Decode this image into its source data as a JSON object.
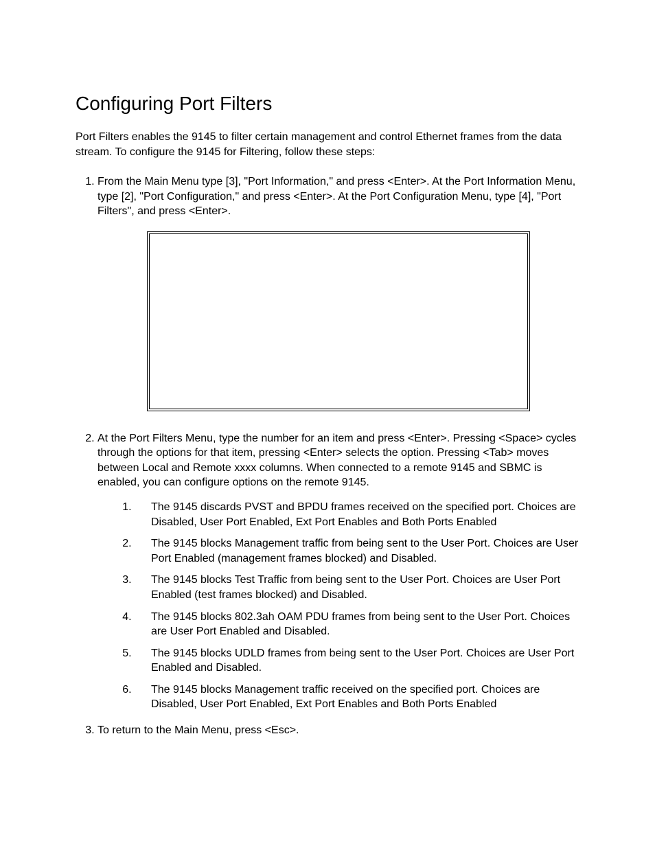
{
  "title": "Configuring Port Filters",
  "intro": "Port Filters enables the 9145 to filter certain management and control Ethernet frames from the data stream.  To configure the 9145 for Filtering, follow these steps:",
  "steps": {
    "s1": "From the Main Menu type [3], \"Port Information,\" and press <Enter>.  At the Port Information Menu, type [2], \"Port Configuration,\" and press <Enter>.  At the Port Configuration Menu, type [4], \"Port Filters\", and press <Enter>.",
    "s2": "At the Port Filters Menu, type the number for an item and press <Enter>.  Pressing <Space> cycles through the options for that item, pressing <Enter> selects the option.  Pressing <Tab> moves between Local and Remote xxxx columns.  When connected to a remote 9145 and SBMC is enabled, you can configure options on the remote 9145.",
    "s3": "To return to the Main Menu, press <Esc>."
  },
  "subitems": {
    "i1": "The 9145 discards PVST and BPDU frames received on the specified port. Choices are Disabled, User Port Enabled, Ext Port Enables and Both Ports Enabled",
    "i2": "The 9145 blocks Management traffic from being sent to the User Port.  Choices are User Port Enabled (management frames blocked) and Disabled.",
    "i3": "The 9145 blocks Test Traffic from being sent to the User Port.  Choices are User Port Enabled (test frames blocked) and Disabled.",
    "i4": "The 9145 blocks 802.3ah OAM PDU frames from being sent to the User Port.  Choices are User Port Enabled and Disabled.",
    "i5": "The 9145 blocks UDLD frames from being sent to the User Port.  Choices are User Port Enabled and Disabled.",
    "i6": "The 9145 blocks Management traffic received on the specified port. Choices are Disabled, User Port Enabled, Ext Port Enables and Both Ports Enabled"
  }
}
